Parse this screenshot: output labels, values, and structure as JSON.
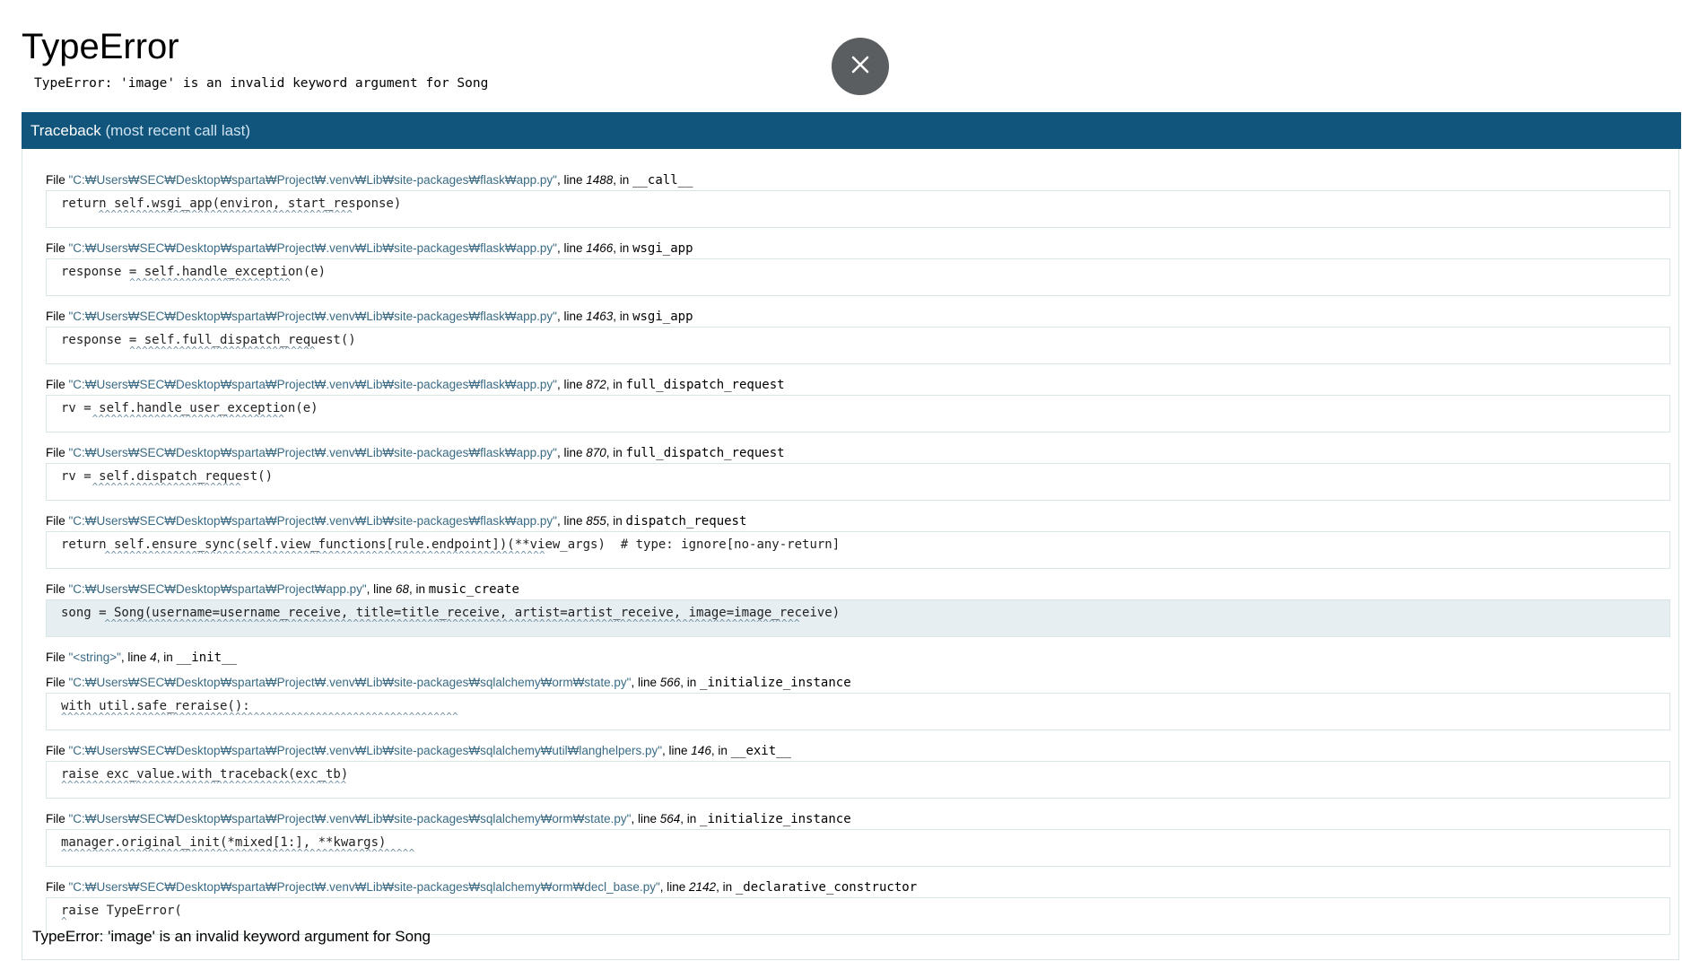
{
  "error": {
    "title": "TypeError",
    "message": "TypeError: 'image' is an invalid keyword argument for Song"
  },
  "close_button": {
    "icon": "close-icon"
  },
  "traceback": {
    "header": "Traceback",
    "header_sub": "(most recent call last)",
    "frames": [
      {
        "file": "\"C:₩Users₩SEC₩Desktop₩sparta₩Project₩.venv₩Lib₩site-packages₩flask₩app.py\"",
        "line": "1488",
        "func": "__call__",
        "code": "return self.wsgi_app(environ, start_response)",
        "marks": "      ^^^^^^^^^^^^^^^^^^^^^^^^^^^^^^^^^^^^^^^^^"
      },
      {
        "file": "\"C:₩Users₩SEC₩Desktop₩sparta₩Project₩.venv₩Lib₩site-packages₩flask₩app.py\"",
        "line": "1466",
        "func": "wsgi_app",
        "code": "response = self.handle_exception(e)",
        "marks": "           ^^^^^^^^^^^^^^^^^^^^^^^^^^"
      },
      {
        "file": "\"C:₩Users₩SEC₩Desktop₩sparta₩Project₩.venv₩Lib₩site-packages₩flask₩app.py\"",
        "line": "1463",
        "func": "wsgi_app",
        "code": "response = self.full_dispatch_request()",
        "marks": "           ^^^^^^^^^^^^^^^^^^^^^^^^^^^^^^"
      },
      {
        "file": "\"C:₩Users₩SEC₩Desktop₩sparta₩Project₩.venv₩Lib₩site-packages₩flask₩app.py\"",
        "line": "872",
        "func": "full_dispatch_request",
        "code": "rv = self.handle_user_exception(e)",
        "marks": "     ^^^^^^^^^^^^^^^^^^^^^^^^^^^^^^^"
      },
      {
        "file": "\"C:₩Users₩SEC₩Desktop₩sparta₩Project₩.venv₩Lib₩site-packages₩flask₩app.py\"",
        "line": "870",
        "func": "full_dispatch_request",
        "code": "rv = self.dispatch_request()",
        "marks": "     ^^^^^^^^^^^^^^^^^^^^^^^^"
      },
      {
        "file": "\"C:₩Users₩SEC₩Desktop₩sparta₩Project₩.venv₩Lib₩site-packages₩flask₩app.py\"",
        "line": "855",
        "func": "dispatch_request",
        "code": "return self.ensure_sync(self.view_functions[rule.endpoint])(**view_args)  # type: ignore[no-any-return]",
        "marks": "       ^^^^^^^^^^^^^^^^^^^^^^^^^^^^^^^^^^^^^^^^^^^^^^^^^^^^^^^^^^^^^^^^^^^^^^^"
      },
      {
        "file": "\"C:₩Users₩SEC₩Desktop₩sparta₩Project₩app.py\"",
        "line": "68",
        "func": "music_create",
        "code": "song = Song(username=username_receive, title=title_receive, artist=artist_receive, image=image_receive)",
        "marks": "       ^^^^^^^^^^^^^^^^^^^^^^^^^^^^^^^^^^^^^^^^^^^^^^^^^^^^^^^^^^^^^^^^^^^^^^^^^^^^^^^^^^^^^^^^^^^^^^^^^^^^^^^^^^^^^^^^",
        "current": true
      },
      {
        "file": "\"<string>\"",
        "line": "4",
        "func": "__init__",
        "code": null,
        "marks": null
      },
      {
        "file": "\"C:₩Users₩SEC₩Desktop₩sparta₩Project₩.venv₩Lib₩site-packages₩sqlalchemy₩orm₩state.py\"",
        "line": "566",
        "func": "_initialize_instance",
        "code": "with util.safe_reraise():",
        "marks": "^^^^^^^^^^^^^^^^^^^^^^^^^^^^^^^^^^^^^^^^^^^^^^^^^^^^^^^^^^^^^^^^"
      },
      {
        "file": "\"C:₩Users₩SEC₩Desktop₩sparta₩Project₩.venv₩Lib₩site-packages₩sqlalchemy₩util₩langhelpers.py\"",
        "line": "146",
        "func": "__exit__",
        "code": "raise exc_value.with_traceback(exc_tb)",
        "marks": "^^^^^^^^^^^^^^^^^^^^^^^^^^^^^^^^^^^^^^^^^^^^^^"
      },
      {
        "file": "\"C:₩Users₩SEC₩Desktop₩sparta₩Project₩.venv₩Lib₩site-packages₩sqlalchemy₩orm₩state.py\"",
        "line": "564",
        "func": "_initialize_instance",
        "code": "manager.original_init(*mixed[1:], **kwargs)",
        "marks": "^^^^^^^^^^^^^^^^^^^^^^^^^^^^^^^^^^^^^^^^^^^^^^^^^^^^^^^^^"
      },
      {
        "file": "\"C:₩Users₩SEC₩Desktop₩sparta₩Project₩.venv₩Lib₩site-packages₩sqlalchemy₩orm₩decl_base.py\"",
        "line": "2142",
        "func": "_declarative_constructor",
        "code": "raise TypeError(",
        "marks": "^"
      }
    ],
    "final_message": "TypeError: 'image' is an invalid keyword argument for Song"
  }
}
